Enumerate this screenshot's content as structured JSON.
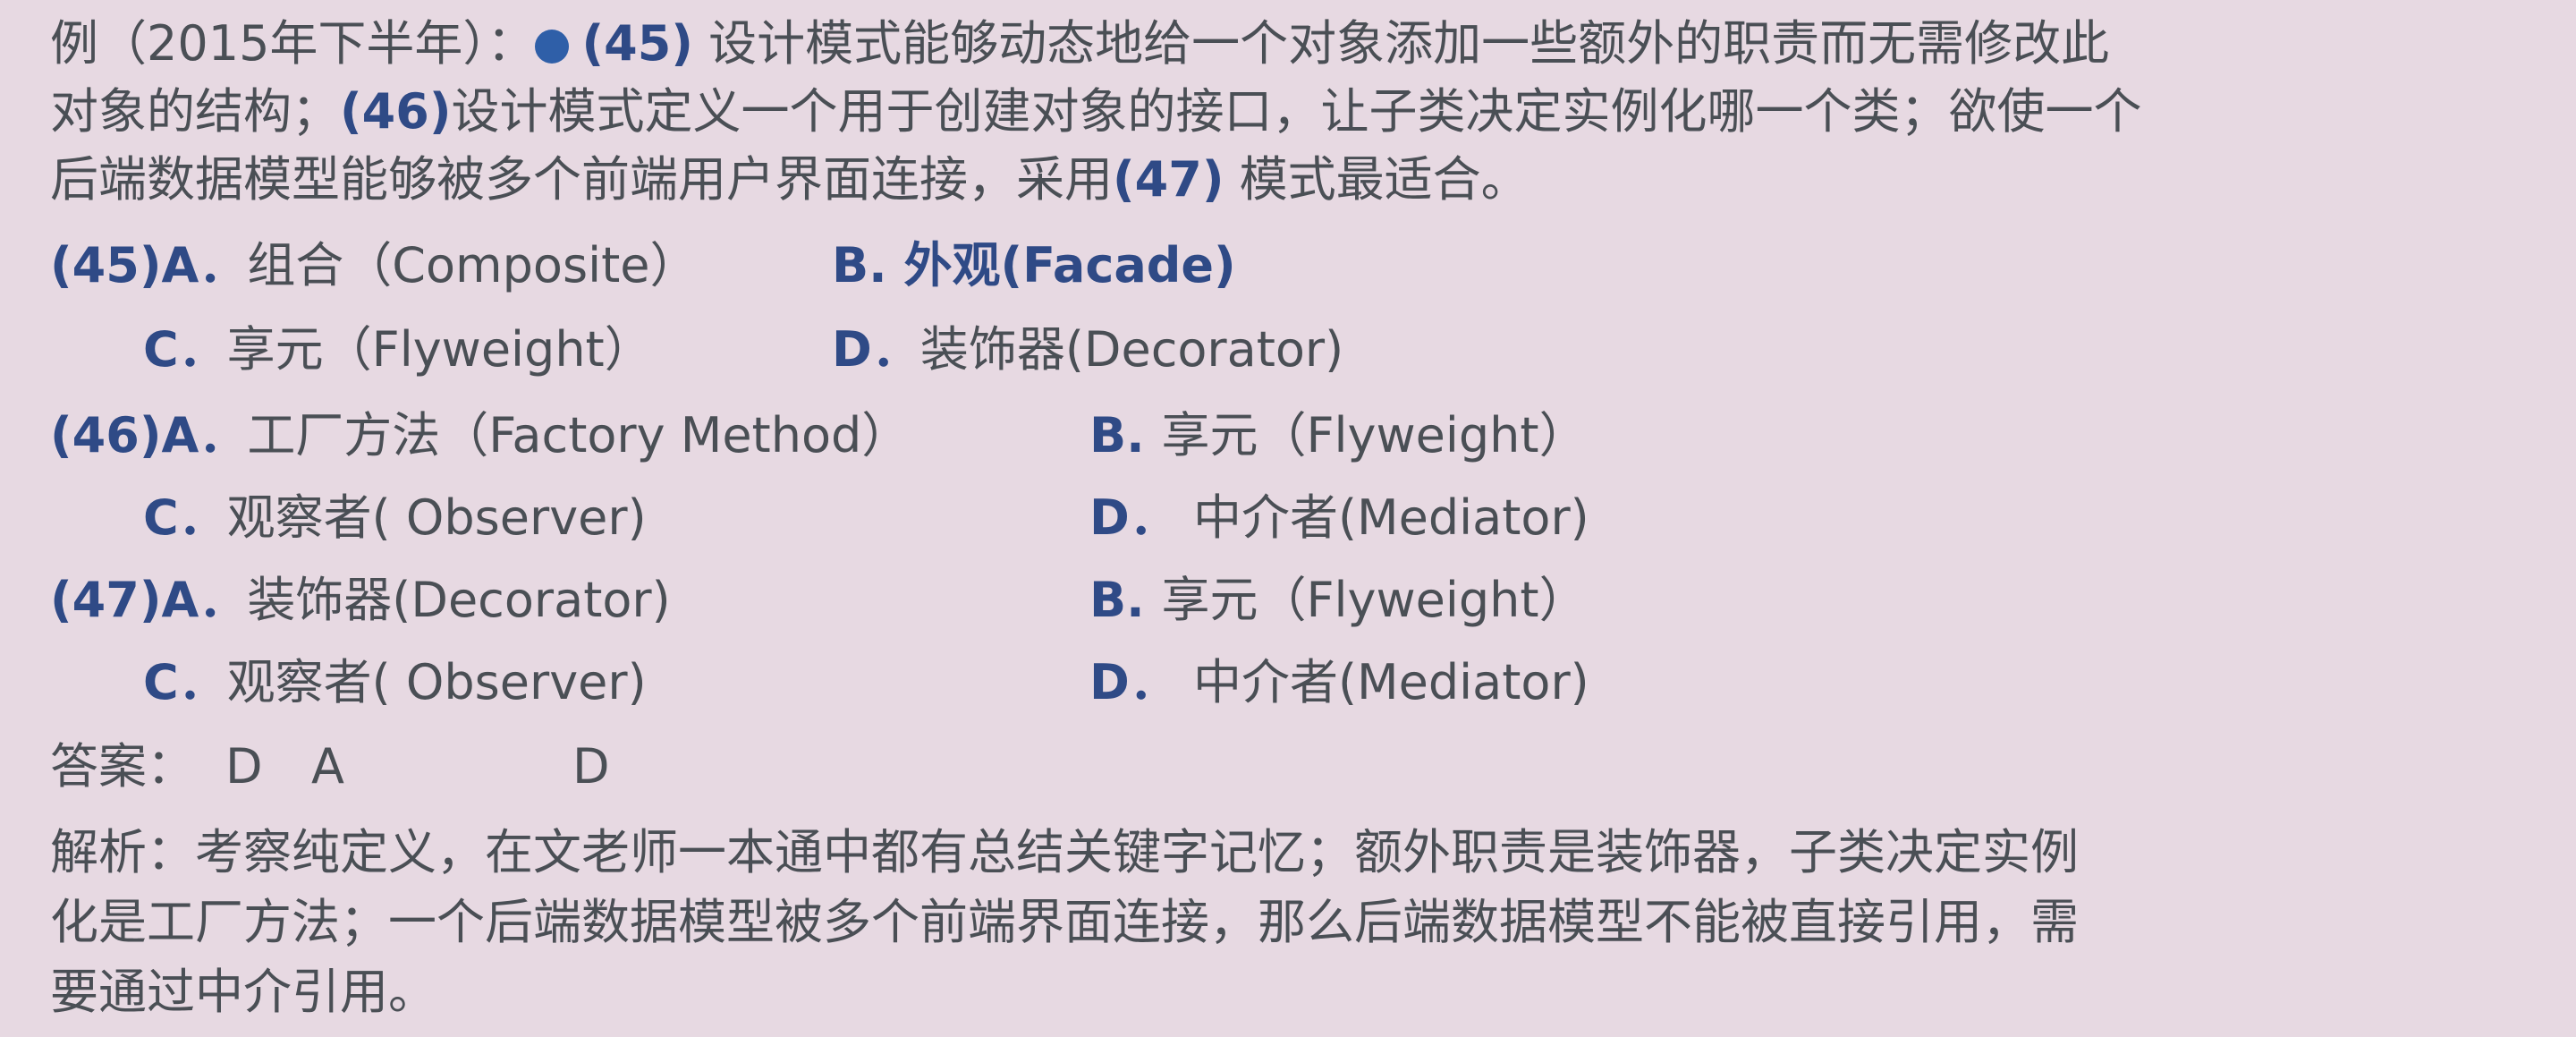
{
  "question": {
    "prefix": "例（2015年下半年）：",
    "line1_a": "(45)",
    "line1_b": " 设计模式能够动态地给一个对象添加一些额外的职责而无需修改此",
    "line2_a": "对象的结构；",
    "line2_b": "(46)",
    "line2_c": "设计模式定义一个用于创建对象的接口，让子类决定实例化哪一个类；欲使一个",
    "line3_a": "后端数据模型能够被多个前端用户界面连接，采用",
    "line3_b": "(47)",
    "line3_c": " 模式最适合。"
  },
  "options": {
    "q45": {
      "a_label": "(45)A．",
      "a_text": "组合（Composite）",
      "b_label": "B. ",
      "b_text": "外观(Facade)",
      "c_label": "C．",
      "c_text": "享元（Flyweight）",
      "d_label": "D．",
      "d_text": "装饰器(Decorator)"
    },
    "q46": {
      "a_label": "(46)A．",
      "a_text": "工厂方法（Factory Method）",
      "b_label": "B. ",
      "b_text": "享元（Flyweight）",
      "c_label": "C．",
      "c_text": "观察者( Observer)",
      "d_label": "D．",
      "d_text": " 中介者(Mediator)"
    },
    "q47": {
      "a_label": "(47)A．",
      "a_text": "装饰器(Decorator)",
      "b_label": "B. ",
      "b_text": "享元（Flyweight）",
      "c_label": "C．",
      "c_text": "观察者( Observer)",
      "d_label": "D．",
      "d_text": " 中介者(Mediator)"
    }
  },
  "answer": {
    "label": "答案：",
    "a1": "D",
    "a2": "A",
    "a3": "D"
  },
  "analysis": {
    "line1": "解析：考察纯定义，在文老师一本通中都有总结关键字记忆；额外职责是装饰器，子类决定实例",
    "line2": "化是工厂方法；一个后端数据模型被多个前端界面连接，那么后端数据模型不能被直接引用，需",
    "line3": "要通过中介引用。"
  }
}
